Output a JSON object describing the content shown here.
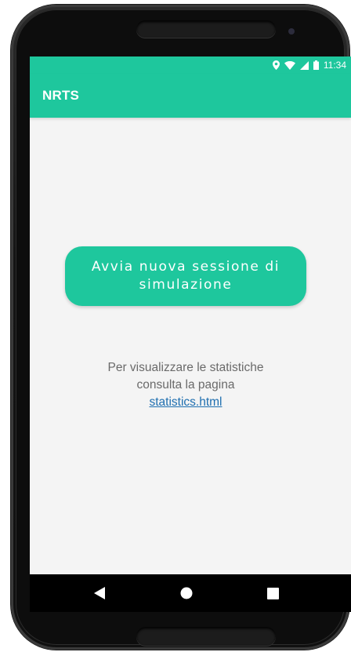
{
  "status_bar": {
    "time": "11:34",
    "icons": [
      "location-icon",
      "wifi-icon",
      "signal-icon",
      "battery-icon"
    ]
  },
  "app_bar": {
    "title": "NRTS"
  },
  "main": {
    "start_button_label": "Avvia nuova sessione di simulazione",
    "info_line_1": "Per visualizzare le statistiche",
    "info_line_2": "consulta la pagina",
    "stats_link": "statistics.html"
  },
  "nav_bar": {
    "buttons": [
      "back-icon",
      "home-icon",
      "recents-icon"
    ]
  },
  "colors": {
    "accent": "#1ec79d",
    "background": "#f4f4f4",
    "link": "#1f6fb0",
    "text_muted": "#6a6a6a"
  }
}
